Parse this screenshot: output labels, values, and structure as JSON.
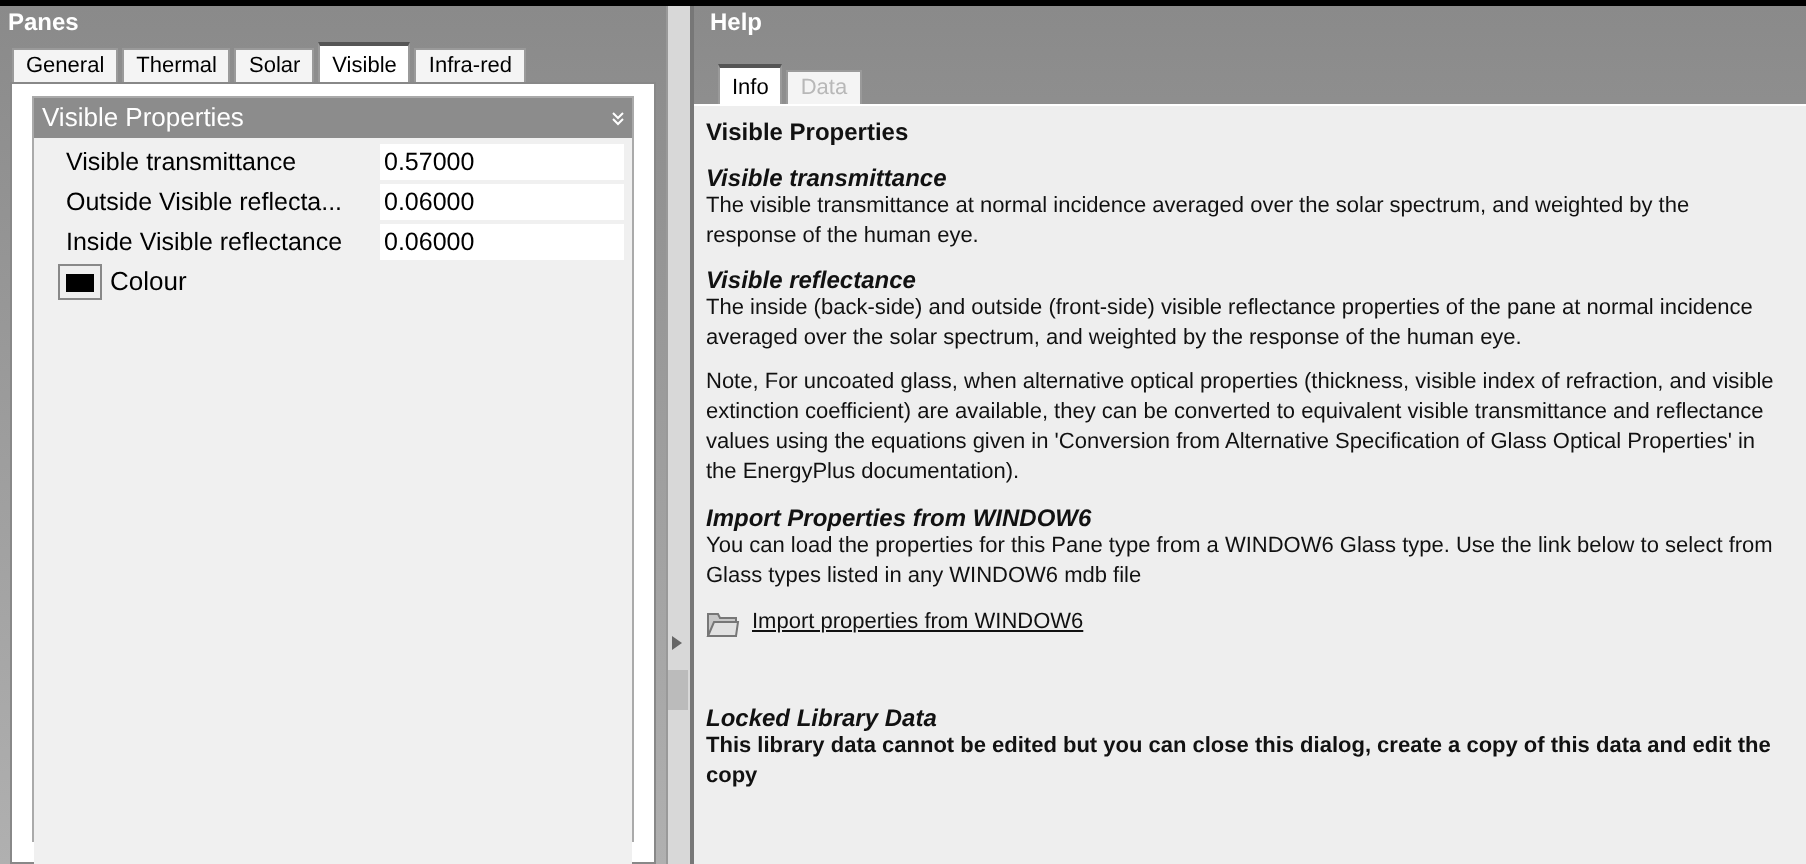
{
  "panes": {
    "title": "Panes",
    "tabs": [
      {
        "label": "General",
        "selected": false
      },
      {
        "label": "Thermal",
        "selected": false
      },
      {
        "label": "Solar",
        "selected": false
      },
      {
        "label": "Visible",
        "selected": true
      },
      {
        "label": "Infra-red",
        "selected": false
      }
    ],
    "section": {
      "title": "Visible Properties",
      "expanded": true,
      "fields": [
        {
          "label": "Visible transmittance",
          "value": "0.57000"
        },
        {
          "label": "Outside Visible reflecta...",
          "value": "0.06000"
        },
        {
          "label": "Inside Visible reflectance",
          "value": "0.06000"
        }
      ],
      "colour": {
        "label": "Colour",
        "color": "#000000"
      }
    }
  },
  "help": {
    "title": "Help",
    "tabs": [
      {
        "label": "Info",
        "selected": true,
        "disabled": false
      },
      {
        "label": "Data",
        "selected": false,
        "disabled": true
      }
    ],
    "blocks": [
      {
        "kind": "title",
        "text": "Visible Properties"
      },
      {
        "kind": "section",
        "heading": "Visible transmittance",
        "text": "The visible transmittance at normal incidence averaged over the solar spectrum, and weighted by the response of the human eye."
      },
      {
        "kind": "section",
        "heading": "Visible reflectance",
        "text": "The inside (back-side) and outside (front-side) visible reflectance properties of the pane at normal incidence averaged over the solar spectrum, and weighted by the response of the human eye."
      },
      {
        "kind": "paragraph",
        "text": "Note, For uncoated glass, when alternative optical properties (thickness, visible index of refraction, and visible extinction coefficient) are available, they can be converted to equivalent visible transmittance and reflectance values using the equations given in 'Conversion from Alternative Specification of Glass Optical Properties' in the EnergyPlus documentation)."
      },
      {
        "kind": "section",
        "heading": "Import Properties from WINDOW6",
        "text": "You can load the properties for this Pane type from a WINDOW6 Glass type. Use the link below to select from Glass types listed in any WINDOW6  mdb file"
      },
      {
        "kind": "link",
        "text": "Import properties from WINDOW6"
      },
      {
        "kind": "warning",
        "heading": "Locked Library Data",
        "text": "This library data cannot be edited but you can close this dialog, create a copy of this data and edit the copy"
      }
    ]
  }
}
